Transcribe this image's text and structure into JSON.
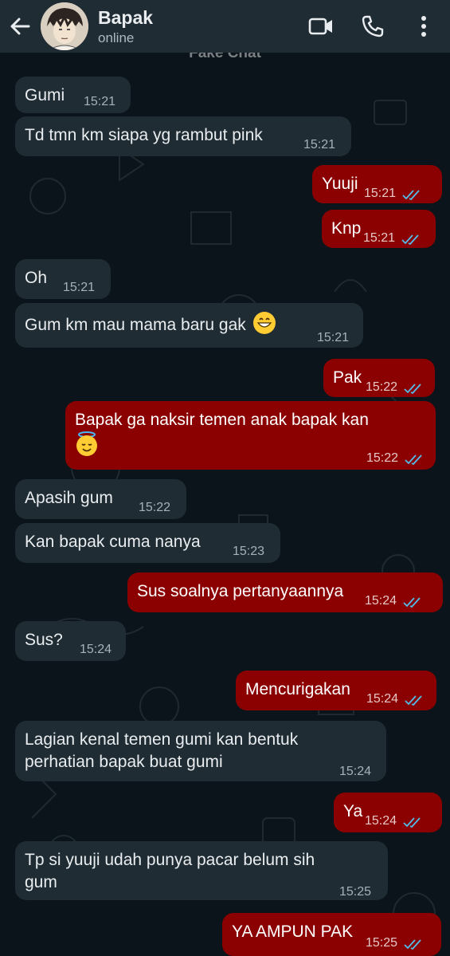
{
  "header": {
    "contact_name": "Bapak",
    "status": "online",
    "watermark": "Fake Chat"
  },
  "icons": {
    "back": "arrow-left-icon",
    "video": "video-camera-icon",
    "call": "phone-icon",
    "menu": "vertical-dots-icon"
  },
  "colors": {
    "outgoing_bubble": "#8b0000",
    "incoming_bubble": "#1f2c33",
    "read_tick": "#53bdeb",
    "header_bg": "#1f2c34"
  },
  "messages": [
    {
      "side": "in",
      "text": "Gumi",
      "time": "15:21"
    },
    {
      "side": "in",
      "text": "Td tmn km siapa yg rambut pink",
      "time": "15:21"
    },
    {
      "side": "out",
      "text": "Yuuji",
      "time": "15:21"
    },
    {
      "side": "out",
      "text": "Knp",
      "time": "15:21"
    },
    {
      "side": "in",
      "text": "Oh",
      "time": "15:21"
    },
    {
      "side": "in",
      "text": "Gum km mau mama baru gak",
      "emoji": "grinning-face-icon",
      "time": "15:21"
    },
    {
      "side": "out",
      "text": "Pak",
      "time": "15:22"
    },
    {
      "side": "out",
      "text": "Bapak ga naksir temen anak bapak kan",
      "emoji": "halo-face-icon",
      "time": "15:22"
    },
    {
      "side": "in",
      "text": "Apasih gum",
      "time": "15:22"
    },
    {
      "side": "in",
      "text": "Kan bapak cuma nanya",
      "time": "15:23"
    },
    {
      "side": "out",
      "text": "Sus soalnya pertanyaannya",
      "time": "15:24"
    },
    {
      "side": "in",
      "text": "Sus?",
      "time": "15:24"
    },
    {
      "side": "out",
      "text": "Mencurigakan",
      "time": "15:24"
    },
    {
      "side": "in",
      "text": "Lagian kenal temen gumi kan bentuk\nperhatian bapak buat gumi",
      "time": "15:24"
    },
    {
      "side": "out",
      "text": "Ya",
      "time": "15:24"
    },
    {
      "side": "in",
      "text": "Tp si yuuji udah punya pacar belum sih\ngum",
      "time": "15:25"
    },
    {
      "side": "out",
      "text": "YA AMPUN PAK",
      "time": "15:25"
    }
  ]
}
